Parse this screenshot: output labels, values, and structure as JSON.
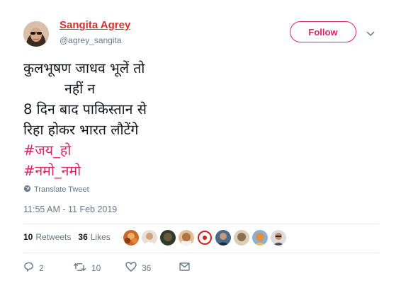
{
  "user": {
    "display_name": "Sangita Agrey",
    "handle": "@agrey_sangita"
  },
  "follow_label": "Follow",
  "tweet": {
    "lines": [
      "कुलभूषण जाधव भूलें तो",
      "नहीं न",
      "8 दिन बाद पाकिस्तान से",
      "रिहा होकर भारत लौटेंगे"
    ],
    "hashtags": [
      "#जय_हो",
      "#नमो_नमो"
    ]
  },
  "translate_label": "Translate Tweet",
  "timestamp": "11:55 AM - 11 Feb 2019",
  "stats": {
    "retweets_count": "10",
    "retweets_label": "Retweets",
    "likes_count": "36",
    "likes_label": "Likes"
  },
  "actions": {
    "replies": "2",
    "retweets": "10",
    "likes": "36"
  },
  "colors": {
    "name": "#d62e2e",
    "accent": "#e0245e",
    "muted": "#657786"
  }
}
